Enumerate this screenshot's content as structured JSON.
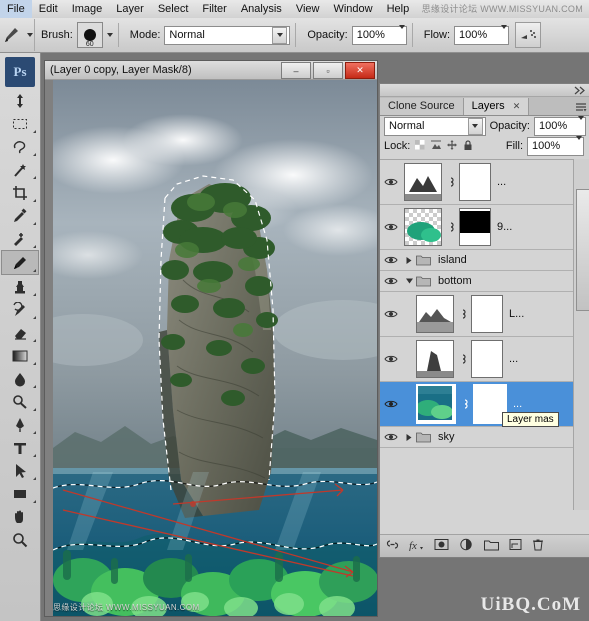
{
  "app": {
    "name": "Adobe Photoshop",
    "badge": "Ps"
  },
  "menubar": {
    "items": [
      "File",
      "Edit",
      "Image",
      "Layer",
      "Select",
      "Filter",
      "Analysis",
      "View",
      "Window",
      "Help"
    ]
  },
  "watermarks": {
    "top_right": "思缘设计论坛 WWW.MISSYUAN.COM",
    "canvas_bottom": "思缘设计论坛 WWW.MISSYUAN.COM",
    "bottom_right": "UiBQ.CoM"
  },
  "options_bar": {
    "brush_label": "Brush:",
    "brush_size": "60",
    "mode_label": "Mode:",
    "mode_value": "Normal",
    "opacity_label": "Opacity:",
    "opacity_value": "100%",
    "flow_label": "Flow:",
    "flow_value": "100%",
    "airbrush_icon": "airbrush-icon",
    "tool_preset_icon": "brush-tool-icon"
  },
  "toolbox": {
    "tools": [
      {
        "name": "move-tool",
        "icon": "move-arrow"
      },
      {
        "name": "marquee-tool",
        "icon": "rect-marquee"
      },
      {
        "name": "lasso-tool",
        "icon": "lasso"
      },
      {
        "name": "magic-wand-tool",
        "icon": "magic-wand"
      },
      {
        "name": "crop-tool",
        "icon": "crop"
      },
      {
        "name": "eyedropper-tool",
        "icon": "eyedropper"
      },
      {
        "name": "healing-brush-tool",
        "icon": "healing-brush"
      },
      {
        "name": "brush-tool",
        "icon": "paint-brush",
        "selected": true
      },
      {
        "name": "clone-stamp-tool",
        "icon": "clone-stamp"
      },
      {
        "name": "history-brush-tool",
        "icon": "history-brush"
      },
      {
        "name": "eraser-tool",
        "icon": "eraser"
      },
      {
        "name": "gradient-tool",
        "icon": "gradient"
      },
      {
        "name": "blur-tool",
        "icon": "blur-drop"
      },
      {
        "name": "dodge-tool",
        "icon": "dodge"
      },
      {
        "name": "pen-tool",
        "icon": "pen"
      },
      {
        "name": "type-tool",
        "icon": "type-T"
      },
      {
        "name": "path-selection-tool",
        "icon": "path-arrow"
      },
      {
        "name": "shape-tool",
        "icon": "rectangle-shape"
      },
      {
        "name": "hand-tool",
        "icon": "hand"
      },
      {
        "name": "zoom-tool",
        "icon": "magnifier"
      }
    ]
  },
  "document": {
    "title": "(Layer 0 copy, Layer Mask/8)",
    "window_buttons": {
      "minimize": "–",
      "maximize": "▫",
      "close": "✕"
    }
  },
  "layers_panel": {
    "tabs": [
      {
        "label": "Clone Source",
        "active": false
      },
      {
        "label": "Layers",
        "active": true,
        "close": "✕"
      }
    ],
    "blend_mode": "Normal",
    "opacity_label": "Opacity:",
    "opacity_value": "100%",
    "lock_label": "Lock:",
    "fill_label": "Fill:",
    "fill_value": "100%",
    "lock_icons": [
      "lock-transparent-icon",
      "lock-image-icon",
      "lock-position-icon",
      "lock-all-icon"
    ],
    "layers": [
      {
        "type": "layer",
        "name": "...",
        "thumb": "mountain-thumb",
        "mask": "white-mask",
        "visible": true,
        "selected": false
      },
      {
        "type": "layer",
        "name": "9...",
        "thumb": "coral-thumb",
        "mask": "black-mask",
        "visible": true,
        "selected": false
      },
      {
        "type": "group",
        "name": "island",
        "visible": true,
        "expanded": false,
        "selected": false
      },
      {
        "type": "group",
        "name": "bottom",
        "visible": true,
        "expanded": true,
        "selected": false
      },
      {
        "type": "layer",
        "name": "L...",
        "thumb": "ridge-thumb",
        "mask": "white-mask",
        "visible": true,
        "selected": false
      },
      {
        "type": "layer",
        "name": "...",
        "thumb": "rock-thumb",
        "mask": "white-mask",
        "visible": true,
        "selected": false
      },
      {
        "type": "layer",
        "name": "...",
        "thumb": "reef-thumb",
        "mask": "white-mask",
        "visible": true,
        "selected": true
      },
      {
        "type": "group",
        "name": "sky",
        "visible": true,
        "expanded": false,
        "selected": false
      }
    ],
    "tooltip": "Layer mas",
    "footer_icons": [
      "link-layers-icon",
      "layer-style-fx-icon",
      "add-mask-icon",
      "adjustment-layer-icon",
      "new-group-icon",
      "new-layer-icon",
      "delete-layer-icon"
    ]
  },
  "colors": {
    "accent_selected": "#4a90d9",
    "panel_bg": "#d4d4d4",
    "chrome_bg": "#757575",
    "close_red": "#c52a17",
    "tooltip_bg": "#ffffe1"
  }
}
